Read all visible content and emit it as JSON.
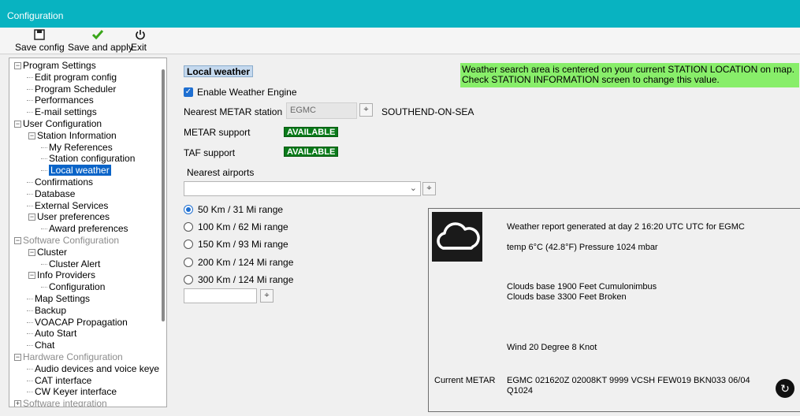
{
  "window": {
    "title": "Configuration"
  },
  "toolbar": {
    "save_config": "Save config",
    "save_apply": "Save and apply",
    "exit": "Exit"
  },
  "tree": [
    {
      "label": "Program Settings",
      "level": 0,
      "expander": "−",
      "grey": false
    },
    {
      "label": "Edit program config",
      "level": 1
    },
    {
      "label": "Program Scheduler",
      "level": 1
    },
    {
      "label": "Performances",
      "level": 1
    },
    {
      "label": "E-mail settings",
      "level": 1
    },
    {
      "label": "User Configuration",
      "level": 0,
      "expander": "−"
    },
    {
      "label": "Station Information",
      "level": 1,
      "expander": "−"
    },
    {
      "label": "My References",
      "level": 2
    },
    {
      "label": "Station configuration",
      "level": 2
    },
    {
      "label": "Local weather",
      "level": 2,
      "selected": true
    },
    {
      "label": "Confirmations",
      "level": 1
    },
    {
      "label": "Database",
      "level": 1
    },
    {
      "label": "External Services",
      "level": 1
    },
    {
      "label": "User preferences",
      "level": 1,
      "expander": "−"
    },
    {
      "label": "Award preferences",
      "level": 2
    },
    {
      "label": "Software Configuration",
      "level": 0,
      "expander": "−",
      "grey": true
    },
    {
      "label": "Cluster",
      "level": 1,
      "expander": "−"
    },
    {
      "label": "Cluster Alert",
      "level": 2
    },
    {
      "label": "Info Providers",
      "level": 1,
      "expander": "−"
    },
    {
      "label": "Configuration",
      "level": 2
    },
    {
      "label": "Map Settings",
      "level": 1
    },
    {
      "label": "Backup",
      "level": 1
    },
    {
      "label": "VOACAP Propagation",
      "level": 1
    },
    {
      "label": "Auto Start",
      "level": 1
    },
    {
      "label": "Chat",
      "level": 1
    },
    {
      "label": "Hardware Configuration",
      "level": 0,
      "expander": "−",
      "grey": true
    },
    {
      "label": "Audio devices and voice keye",
      "level": 1
    },
    {
      "label": "CAT interface",
      "level": 1
    },
    {
      "label": "CW Keyer interface",
      "level": 1
    },
    {
      "label": "Software integration",
      "level": 0,
      "expander": "+",
      "grey": true
    }
  ],
  "main": {
    "section_title": "Local weather",
    "info_banner_line1": "Weather search area is centered on your current STATION LOCATION on map.",
    "info_banner_line2": "Check STATION INFORMATION screen to change this value.",
    "enable_weather": "Enable Weather Engine",
    "enable_weather_checked": true,
    "nearest_metar_label": "Nearest METAR station",
    "nearest_metar_value": "EGMC",
    "nearest_metar_name": "SOUTHEND-ON-SEA",
    "metar_support_label": "METAR support",
    "metar_support_status": "AVAILABLE",
    "taf_support_label": "TAF support",
    "taf_support_status": "AVAILABLE",
    "nearest_airports_label": "Nearest airports",
    "nearest_airports_value": "",
    "ranges": [
      {
        "label": "50 Km / 31 Mi range",
        "selected": true
      },
      {
        "label": "100 Km / 62 Mi range",
        "selected": false
      },
      {
        "label": "150 Km / 93 Mi range",
        "selected": false
      },
      {
        "label": "200 Km / 124 Mi range",
        "selected": false
      },
      {
        "label": "300 Km / 124 Mi range",
        "selected": false
      }
    ],
    "range_input_value": ""
  },
  "weather": {
    "icon": "cloud-icon",
    "report_line": "Weather report generated at day 2 16:20 UTC UTC for EGMC",
    "temp_line": "temp 6°C (42.8°F) Pressure 1024 mbar",
    "clouds_line1": "Clouds base 1900 Feet Cumulonimbus",
    "clouds_line2": "Clouds base 3300 Feet Broken",
    "wind_line": "Wind 20 Degree 8 Knot",
    "current_metar_label": "Current METAR",
    "current_metar_line1": "EGMC 021620Z 02008KT 9999 VCSH FEW019 BKN033 06/04",
    "current_metar_line2": "Q1024"
  },
  "colors": {
    "titlebar": "#08b3c1",
    "banner": "#88ee6a",
    "badge": "#0a7a1a",
    "selection": "#0a64c8"
  }
}
